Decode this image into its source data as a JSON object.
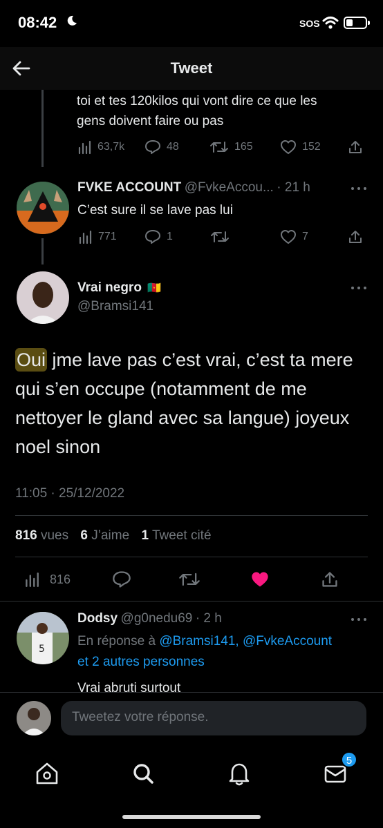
{
  "status": {
    "time": "08:42",
    "sos": "SOS"
  },
  "header": {
    "title": "Tweet"
  },
  "parent_tail": {
    "text_line1": "toi et tes 120kilos qui vont dire ce que les",
    "text_line2": "gens doivent faire ou pas",
    "views": "63,7k",
    "replies": "48",
    "retweets": "165",
    "likes": "152"
  },
  "reply1": {
    "name": "FVKE ACCOUNT",
    "handle": "@FvkeAccou...",
    "time": "· 21 h",
    "text": "C’est sure il se lave pas lui",
    "views": "771",
    "replies": "1",
    "retweets": "",
    "likes": "7"
  },
  "main_tweet": {
    "name": "Vrai negro",
    "flag": "🇨🇲",
    "handle": "@Bramsi141",
    "text_highlight": "Oui",
    "text_rest": " jme lave pas c’est vrai, c’est ta mere qui s’en occupe (notamment de me nettoyer le gland avec sa langue) joyeux noel sinon",
    "timestamp": "11:05 · 25/12/2022",
    "views_count": "816",
    "views_label": "vues",
    "likes_count": "6",
    "likes_label": "J’aime",
    "quotes_count": "1",
    "quotes_label": "Tweet cité",
    "action_views": "816",
    "like_color": "#f91880"
  },
  "reply2": {
    "name": "Dodsy",
    "handle": "@g0nedu69",
    "time": "· 2 h",
    "reply_prefix": "En réponse à",
    "reply_to": "@Bramsi141, @FvkeAccount",
    "reply_more": "et 2 autres personnes",
    "text": "Vrai abruti surtout"
  },
  "compose": {
    "placeholder": "Tweetez votre réponse."
  },
  "bottom_nav": {
    "tabs": [
      "home-icon",
      "search-icon",
      "bell-icon",
      "mail-icon"
    ],
    "mail_badge": "5"
  },
  "colors": {
    "accent": "#1d9bf0",
    "like": "#f91880",
    "highlight": "#5a4d12"
  }
}
